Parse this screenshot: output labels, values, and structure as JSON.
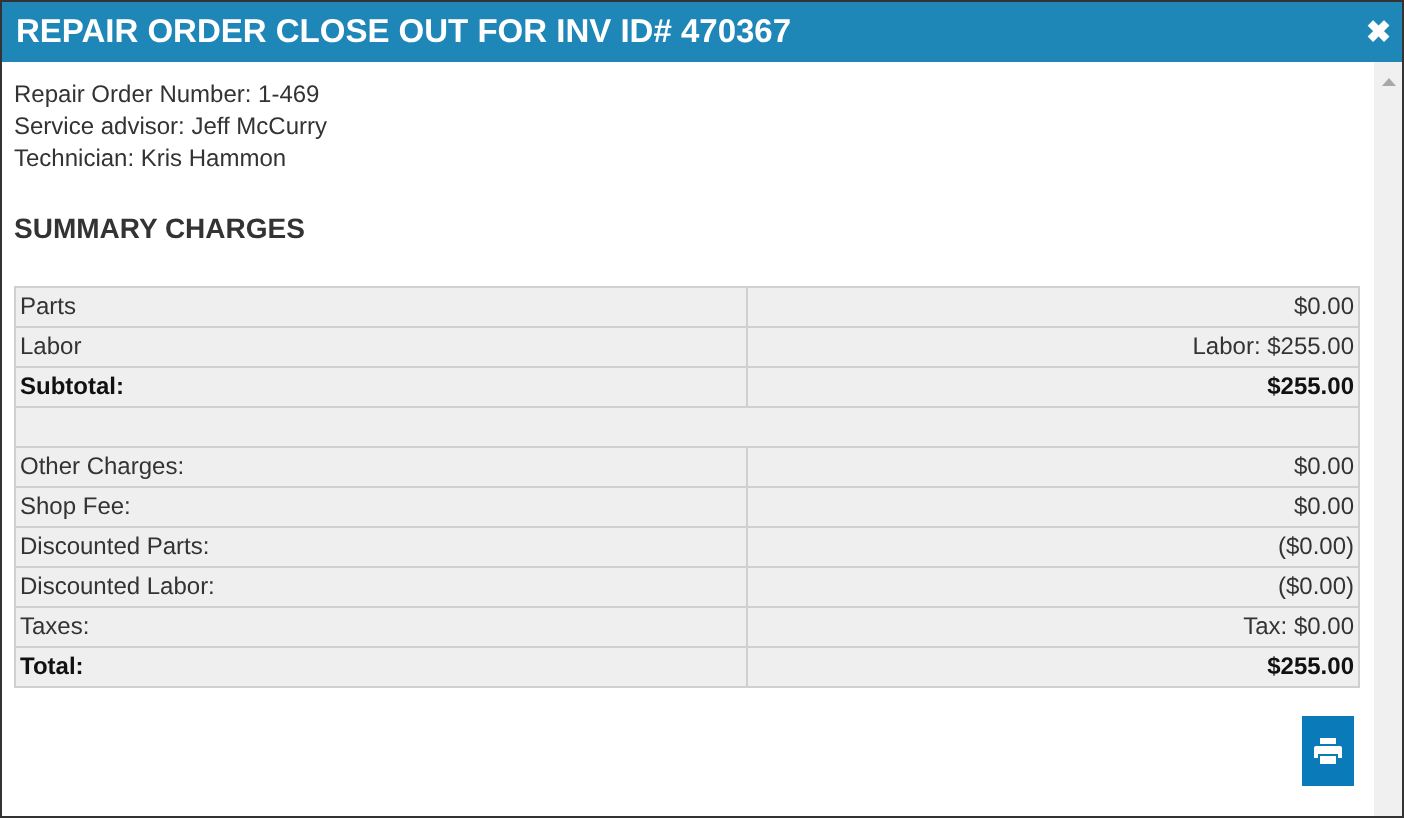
{
  "window": {
    "title": "REPAIR ORDER CLOSE OUT FOR INV ID# 470367",
    "close": "✖"
  },
  "info": [
    "Repair Order Number: 1-469",
    "Service advisor: Jeff McCurry",
    "Technician: Kris Hammon"
  ],
  "section_title": "SUMMARY CHARGES",
  "rows": [
    {
      "kind": "item",
      "label": "Parts",
      "value": "$0.00"
    },
    {
      "kind": "item",
      "label": "Labor",
      "value": "Labor: $255.00"
    },
    {
      "kind": "total",
      "label": "Subtotal:",
      "value": "$255.00"
    },
    {
      "kind": "spacer"
    },
    {
      "kind": "item",
      "label": "Other Charges:",
      "value": "$0.00"
    },
    {
      "kind": "item",
      "label": "Shop Fee:",
      "value": "$0.00"
    },
    {
      "kind": "item",
      "label": "Discounted Parts:",
      "value": "($0.00)"
    },
    {
      "kind": "item",
      "label": "Discounted Labor:",
      "value": "($0.00)"
    },
    {
      "kind": "item",
      "label": "Taxes:",
      "value": "Tax: $0.00"
    },
    {
      "kind": "total",
      "label": "Total:",
      "value": "$255.00"
    }
  ]
}
